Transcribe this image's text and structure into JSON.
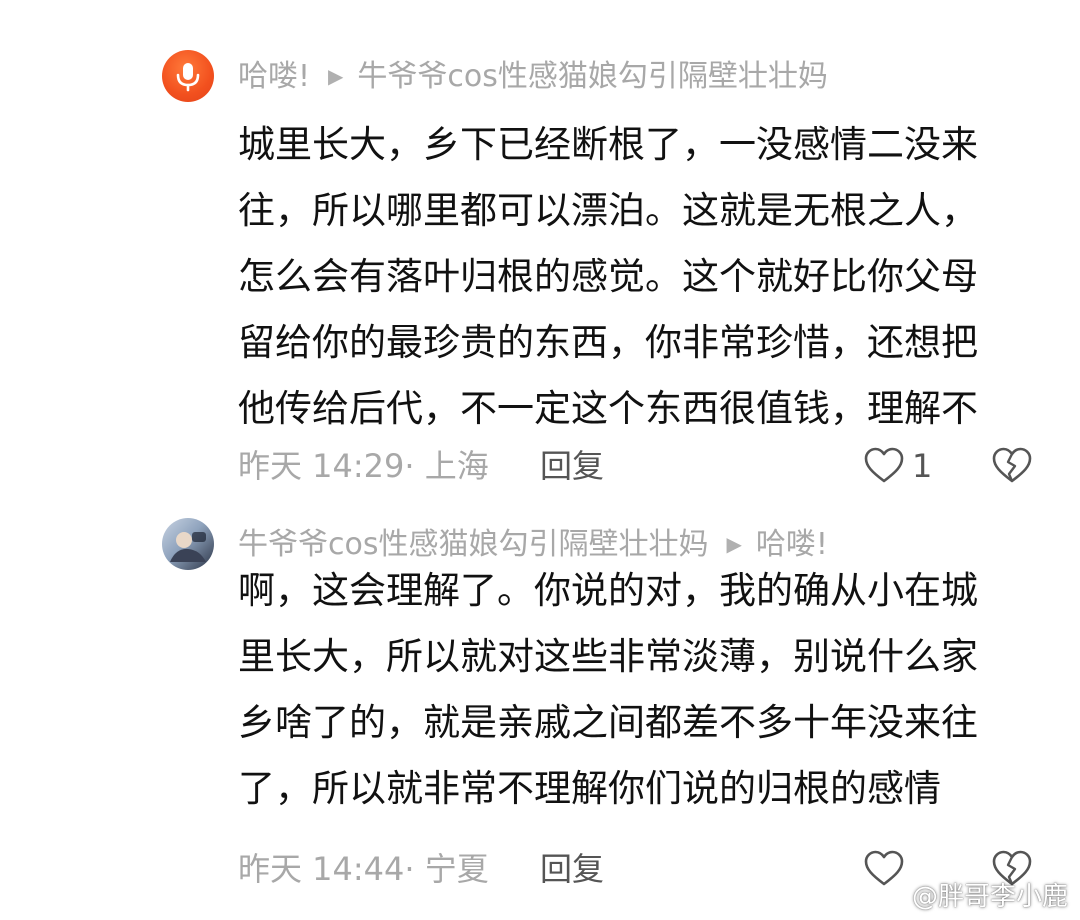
{
  "comments": [
    {
      "author": "哈喽!",
      "reply_to": "牛爷爷cos性感猫娘勾引隔壁壮壮妈",
      "avatar_icon": "microphone-icon",
      "text_lines": [
        "城里长大，乡下已经断根了，一没感情二没来",
        "往，所以哪里都可以漂泊。这就是无根之人，",
        "怎么会有落叶归根的感觉。这个就好比你父母",
        "留给你的最珍贵的东西，你非常珍惜，还想把",
        "他传给后代，不一定这个东西很值钱，理解不"
      ],
      "time": "昨天 14:29",
      "location": "上海",
      "meta": "昨天 14:29· 上海",
      "reply_label": "回复",
      "like_count": "1"
    },
    {
      "author": "牛爷爷cos性感猫娘勾引隔壁壮壮妈",
      "reply_to": "哈喽!",
      "avatar_icon": "user-photo",
      "text_lines": [
        "啊，这会理解了。你说的对，我的确从小在城",
        "里长大，所以就对这些非常淡薄，别说什么家",
        "乡啥了的，就是亲戚之间都差不多十年没来往",
        "了，所以就非常不理解你们说的归根的感情"
      ],
      "time": "昨天 14:44",
      "location": "宁夏",
      "meta": "昨天 14:44· 宁夏",
      "reply_label": "回复",
      "like_count": ""
    }
  ],
  "watermark": {
    "text": "@胖哥李小鹿",
    "icon": "weibo-icon"
  },
  "colors": {
    "text": "#111111",
    "secondary": "#a8a8a8",
    "avatar_orange": "#f2501e"
  }
}
